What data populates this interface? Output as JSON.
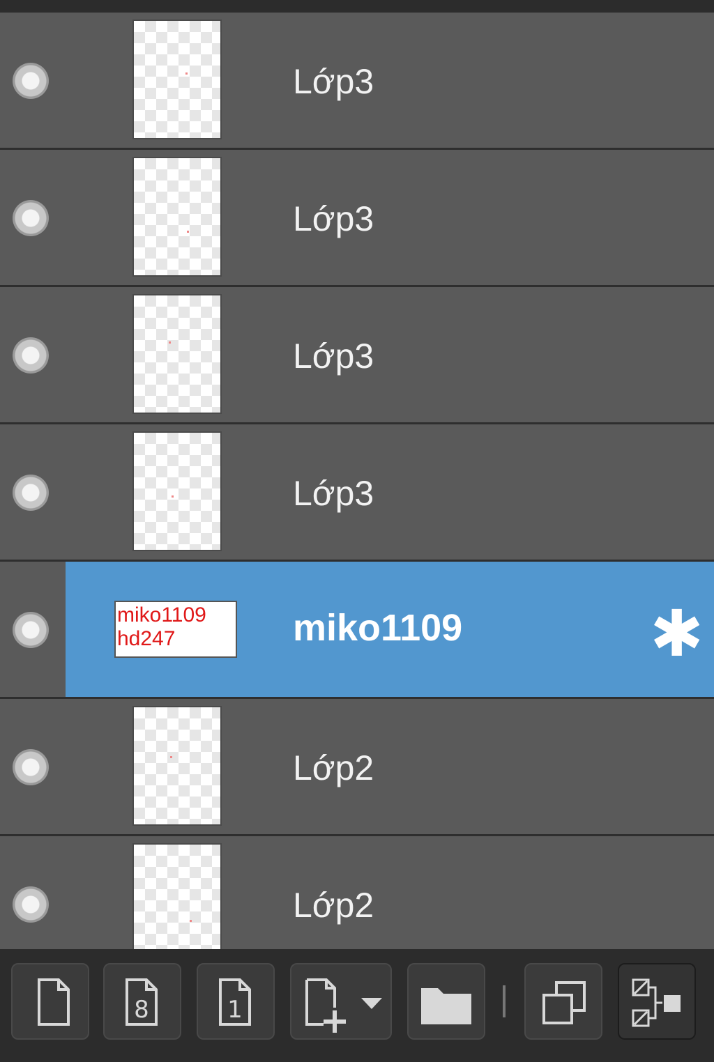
{
  "layers": [
    {
      "name": "Lớp3",
      "visible": true,
      "selected": false
    },
    {
      "name": "Lớp3",
      "visible": true,
      "selected": false
    },
    {
      "name": "Lớp3",
      "visible": true,
      "selected": false
    },
    {
      "name": "Lớp3",
      "visible": true,
      "selected": false
    },
    {
      "name": "miko1109",
      "visible": true,
      "selected": true,
      "thumb_text": [
        "miko1109",
        "hd247"
      ]
    },
    {
      "name": "Lớp2",
      "visible": true,
      "selected": false
    },
    {
      "name": "Lớp2",
      "visible": true,
      "selected": false
    }
  ],
  "toolbar": {
    "buttons": [
      {
        "name": "new-raster-layer-button",
        "icon": "page-icon"
      },
      {
        "name": "new-8bit-layer-button",
        "icon": "page-8-icon",
        "label": "8"
      },
      {
        "name": "new-1bit-layer-button",
        "icon": "page-1-icon",
        "label": "1"
      },
      {
        "name": "add-layer-dropdown-button",
        "icon": "page-plus-icon"
      },
      {
        "name": "new-folder-button",
        "icon": "folder-icon"
      },
      {
        "name": "duplicate-layer-button",
        "icon": "duplicate-icon"
      },
      {
        "name": "merge-down-button",
        "icon": "merge-icon"
      }
    ]
  },
  "colors": {
    "panel": "#5a5a5a",
    "selected": "#5297cf",
    "toolbar": "#2c2c2c",
    "thumb_text": "#e01818"
  }
}
